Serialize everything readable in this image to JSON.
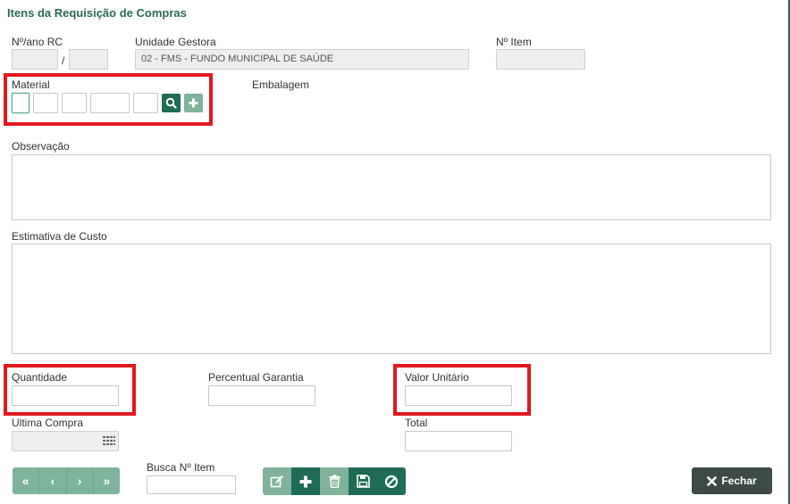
{
  "panel": {
    "title": "Itens da Requisição de Compras"
  },
  "labels": {
    "nro_ano_rc": "Nº/ano RC",
    "separator": "/",
    "unidade_gestora": "Unidade Gestora",
    "nro_item": "Nº Item",
    "material": "Material",
    "embalagem": "Embalagem",
    "observacao": "Observação",
    "estimativa": "Estimativa de Custo",
    "quantidade": "Quantidade",
    "percentual_garantia": "Percentual Garantia",
    "valor_unitario": "Valor Unitário",
    "ultima_compra": "Ultima Compra",
    "total": "Total",
    "busca_item": "Busca Nº Item"
  },
  "values": {
    "unidade_gestora": "02 - FMS - FUNDO MUNICIPAL DE SAÚDE"
  },
  "buttons": {
    "fechar": "Fechar",
    "nav_first": "«",
    "nav_prev": "‹",
    "nav_next": "›",
    "nav_last": "»"
  },
  "icons": {
    "search": "search-icon",
    "add": "plus-icon",
    "edit": "edit-icon",
    "trash": "trash-icon",
    "save": "save-icon",
    "cancel": "cancel-icon",
    "close": "close-icon",
    "calendar": "calendar-icon"
  },
  "colors": {
    "accent_dark": "#1f6b55",
    "accent_light": "#7fb39c",
    "highlight": "#e0191f",
    "title": "#2b6b4e",
    "close_button": "#3d4a46"
  }
}
